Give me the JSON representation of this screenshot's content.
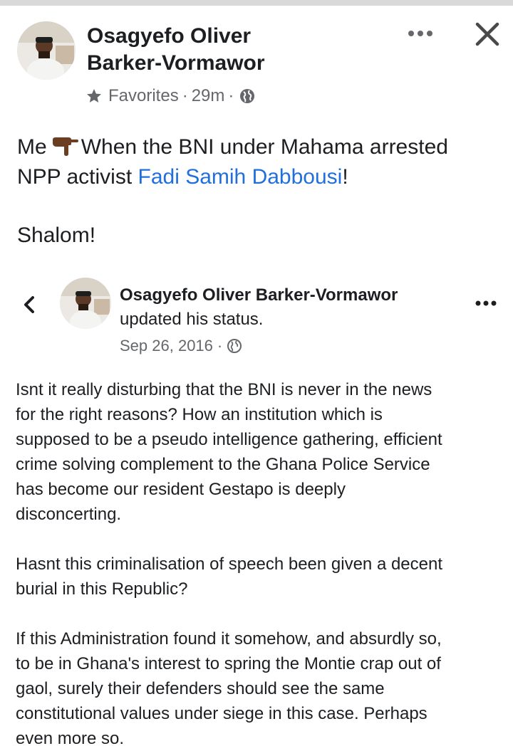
{
  "post": {
    "author_line1": "Osagyefo Oliver",
    "author_line2": "Barker-Vormawor",
    "audience": "Favorites",
    "separator": "·",
    "time": "29m",
    "text": {
      "line1_prefix": "Me",
      "line1_suffix": "When the BNI under Mahama arrested",
      "line2_prefix": "NPP activist",
      "line2_link": "Fadi Samih Dabbousi",
      "line2_suffix": "!",
      "line3": "Shalom!"
    }
  },
  "shared": {
    "author": "Osagyefo Oliver Barker-Vormawor",
    "action": "updated his status.",
    "date": "Sep 26, 2016",
    "separator": "·",
    "body": [
      "Isnt it really disturbing that the BNI is never in the news",
      "for the right reasons? How an institution which is",
      "supposed to be a pseudo intelligence gathering, efficient",
      "crime solving complement to the Ghana Police Service",
      "has become our resident Gestapo is deeply",
      "disconcerting.",
      "",
      "Hasnt this criminalisation of speech been given a decent",
      "burial in this Republic?",
      "",
      "If this Administration found it somehow, and absurdly so,",
      "to be in Ghana's interest to spring the Montie crap out of",
      "gaol, surely their defenders should see the same",
      "constitutional values under siege in this case. Perhaps",
      "even more so."
    ]
  },
  "icons": {
    "star": "star-icon",
    "globe": "globe-icon",
    "more": "more-options-icon",
    "close": "close-icon",
    "back": "chevron-left-icon",
    "emoji": "backhand-index-pointing-down-emoji"
  },
  "colors": {
    "text": "#1c1e21",
    "meta": "#65676b",
    "link": "#216fdb",
    "topbar": "#d9d9d9"
  }
}
